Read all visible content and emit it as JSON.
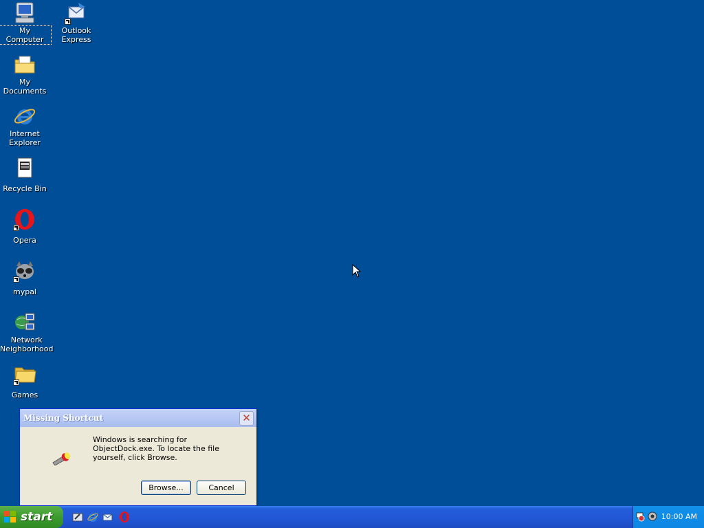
{
  "desktop": {
    "icons": [
      {
        "label": "My Computer",
        "icon": "my-computer-icon"
      },
      {
        "label": "Outlook Express",
        "icon": "outlook-express-icon"
      },
      {
        "label": "My Documents",
        "icon": "my-documents-icon"
      },
      {
        "label": "Internet Explorer",
        "icon": "internet-explorer-icon"
      },
      {
        "label": "Recycle Bin",
        "icon": "recycle-bin-icon"
      },
      {
        "label": "Opera",
        "icon": "opera-icon"
      },
      {
        "label": "mypal",
        "icon": "mypal-icon"
      },
      {
        "label": "Network Neighborhood",
        "icon": "network-neighborhood-icon"
      },
      {
        "label": "Games",
        "icon": "games-folder-icon"
      }
    ]
  },
  "dialog": {
    "title": "Missing Shortcut",
    "message": "Windows is searching for ObjectDock.exe. To locate the file yourself, click Browse.",
    "browse_label": "Browse...",
    "cancel_label": "Cancel"
  },
  "taskbar": {
    "start_label": "start",
    "quick_launch": [
      "show-desktop-icon",
      "internet-explorer-icon",
      "outlook-express-icon",
      "opera-icon"
    ],
    "clock": "10:00 AM"
  },
  "colors": {
    "desktop_bg": "#004e98",
    "taskbar": "#245edb",
    "start_button": "#3c9b2d",
    "tray": "#0d86e4"
  }
}
